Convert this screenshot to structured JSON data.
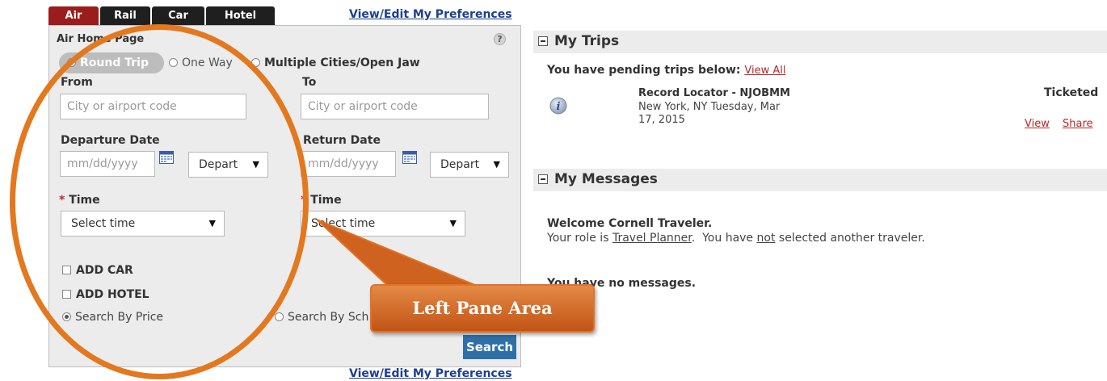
{
  "tabs": [
    {
      "label": "Air",
      "active": true
    },
    {
      "label": "Rail",
      "active": false
    },
    {
      "label": "Car",
      "active": false
    },
    {
      "label": "Hotel",
      "active": false
    }
  ],
  "preferences_link": "View/Edit My Preferences",
  "air_form": {
    "heading": "Air Home Page",
    "help_icon": "question-icon",
    "trip_types": [
      "Round Trip",
      "One Way",
      "Multiple Cities/Open Jaw"
    ],
    "selected_trip_type": "Round Trip",
    "from": {
      "label": "From",
      "placeholder": "City or airport code"
    },
    "to": {
      "label": "To",
      "placeholder": "City or airport code"
    },
    "departure_date": {
      "label": "Departure Date",
      "placeholder": "mm/dd/yyyy",
      "mode": "Depart"
    },
    "return_date": {
      "label": "Return Date",
      "placeholder": "mm/dd/yyyy",
      "mode": "Depart"
    },
    "departure_time": {
      "required_marker": "*",
      "label": "Time",
      "value": "Select time"
    },
    "return_time": {
      "required_marker": "*",
      "label": "Time",
      "value": "Select time"
    },
    "add_car": "ADD CAR",
    "add_hotel": "ADD HOTEL",
    "search_options": [
      "Search By Price",
      "Search By Sch"
    ],
    "selected_search": "Search By Price",
    "search_button": "Search"
  },
  "my_trips": {
    "title": "My Trips",
    "pending_text": "You have pending trips below:",
    "view_all": "View All",
    "trip": {
      "locator": "Record Locator - NJOBMM",
      "details_line1": "New York, NY Tuesday, Mar",
      "details_line2": "17, 2015",
      "status": "Ticketed",
      "view": "View",
      "share": "Share",
      "icon": "info-icon"
    }
  },
  "my_messages": {
    "title": "My Messages",
    "welcome": "Welcome Cornell Traveler.",
    "role_prefix": "Your role is",
    "role": "Travel Planner",
    "role_mid": ".  You have",
    "not_word": "not",
    "role_suffix": "selected another traveler.",
    "no_messages": "You have no messages."
  },
  "annotation": {
    "callout_text": "Left Pane Area",
    "accent_color": "#e3781e"
  }
}
